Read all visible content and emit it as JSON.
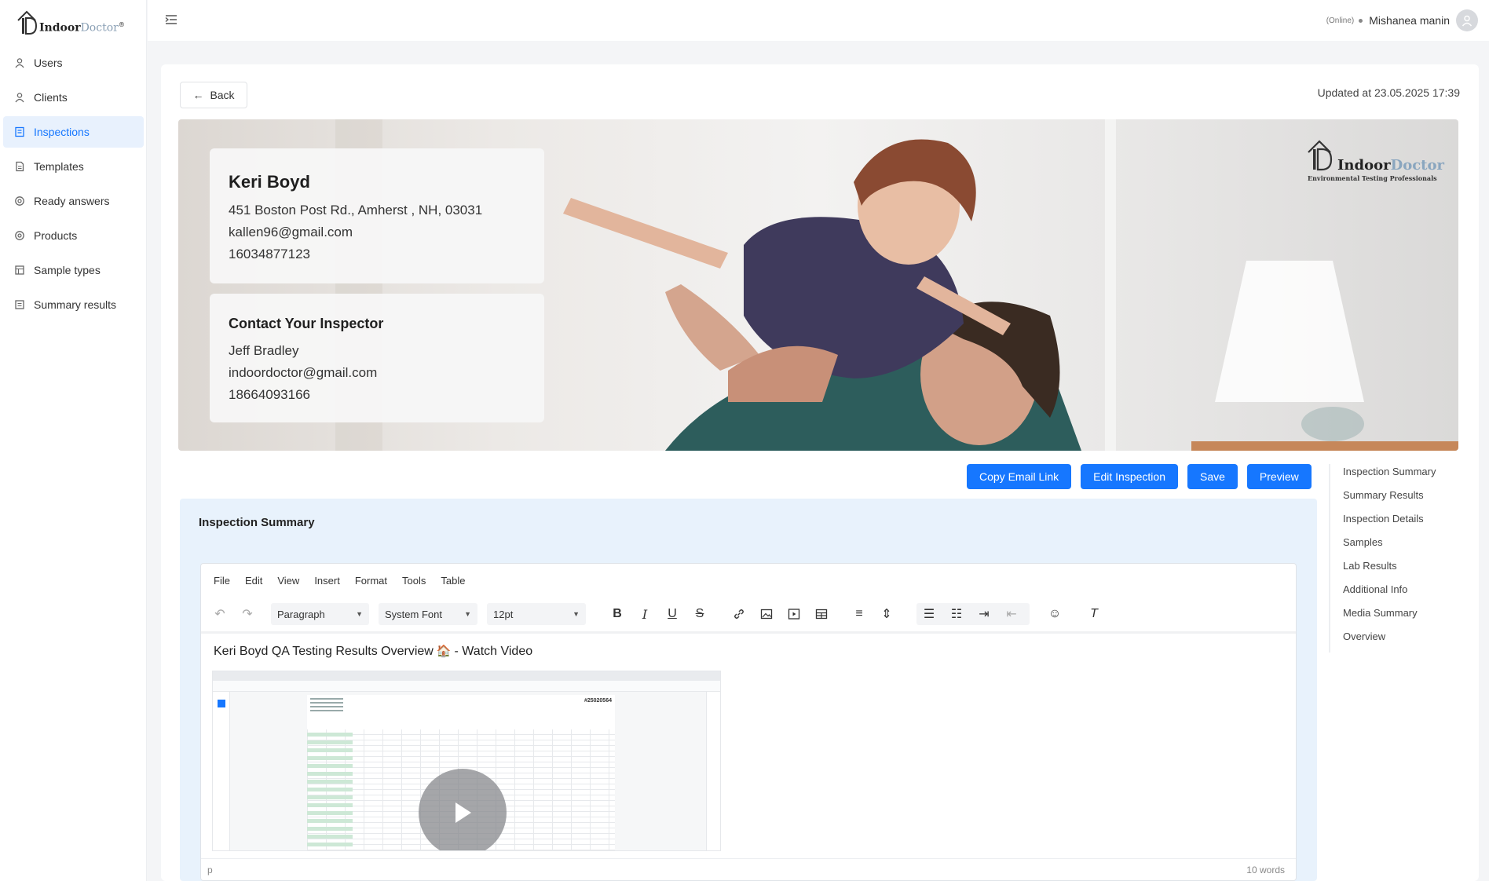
{
  "app": {
    "logo_text_main": "Indoor",
    "logo_text_dim": "Doctor",
    "logo_reg": "®"
  },
  "sidebar": {
    "items": [
      {
        "label": "Users",
        "icon": "users-icon",
        "active": false
      },
      {
        "label": "Clients",
        "icon": "clients-icon",
        "active": false
      },
      {
        "label": "Inspections",
        "icon": "inspections-icon",
        "active": true
      },
      {
        "label": "Templates",
        "icon": "templates-icon",
        "active": false
      },
      {
        "label": "Ready answers",
        "icon": "ready-answers-icon",
        "active": false
      },
      {
        "label": "Products",
        "icon": "products-icon",
        "active": false
      },
      {
        "label": "Sample types",
        "icon": "sample-types-icon",
        "active": false
      },
      {
        "label": "Summary results",
        "icon": "summary-results-icon",
        "active": false
      }
    ]
  },
  "header": {
    "status": "(Online)",
    "user_name": "Mishanea manin"
  },
  "page": {
    "back_label": "Back",
    "updated": "Updated at 23.05.2025 17:39"
  },
  "hero": {
    "client": {
      "name": "Keri Boyd",
      "address": "451 Boston Post Rd., Amherst , NH, 03031",
      "email": "kallen96@gmail.com",
      "phone": "16034877123"
    },
    "inspector": {
      "heading": "Contact Your Inspector",
      "name": "Jeff Bradley",
      "email": "indoordoctor@gmail.com",
      "phone": "18664093166"
    },
    "logo_main": "Indoor",
    "logo_dim": "Doctor",
    "logo_sub": "Environmental Testing Professionals"
  },
  "actions": {
    "copy_email": "Copy Email Link",
    "edit": "Edit Inspection",
    "save": "Save",
    "preview": "Preview"
  },
  "anchor_nav": [
    "Inspection Summary",
    "Summary Results",
    "Inspection Details",
    "Samples",
    "Lab Results",
    "Additional Info",
    "Media Summary",
    "Overview"
  ],
  "summary": {
    "title": "Inspection Summary"
  },
  "editor": {
    "menu": [
      "File",
      "Edit",
      "View",
      "Insert",
      "Format",
      "Tools",
      "Table"
    ],
    "block_format": "Paragraph",
    "font_family": "System Font",
    "font_size": "12pt",
    "content_text_before": "Keri Boyd QA Testing Results Overview",
    "content_text_after": "- Watch Video",
    "video_report_number": "#25020564",
    "status_path": "p",
    "word_count": "10 words"
  },
  "colors": {
    "primary": "#1677ff",
    "active_bg": "#e8f1fd",
    "summary_bg": "#e8f2fc"
  }
}
